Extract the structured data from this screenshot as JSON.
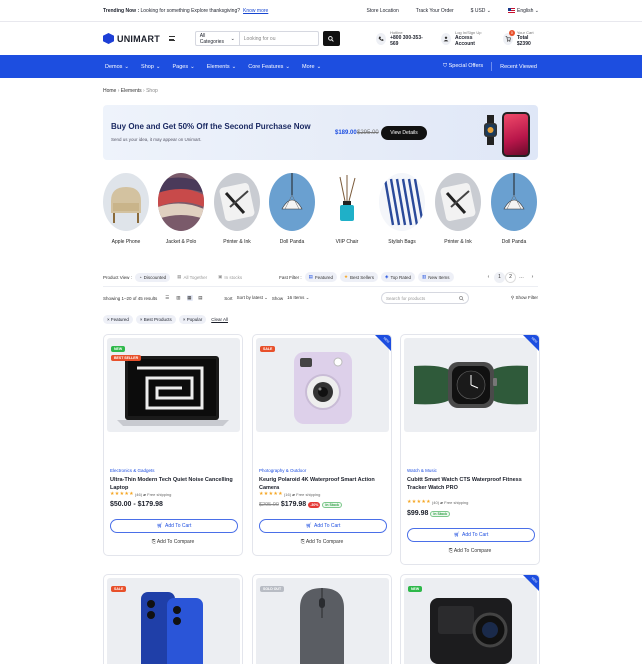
{
  "topbar": {
    "trending_label": "Trending Now :",
    "trending_text": "Looking for something Explore thanksgiving?",
    "know_more": "Know more",
    "store_location": "Store Location",
    "track_order": "Track Your Order",
    "currency": "$ USD",
    "language": "English"
  },
  "header": {
    "logo": "UNIMART",
    "category_select": "All Categories",
    "search_placeholder": "Looking for ou",
    "hotline_label": "Hotline",
    "hotline_number": "+800 300-353-569",
    "login_label": "Log In/Sign Up",
    "account_label": "Access Account",
    "cart_label": "Your Cart",
    "cart_total": "Total $2390",
    "cart_count": "0"
  },
  "nav": {
    "items": [
      "Demos",
      "Shop",
      "Pages",
      "Elements",
      "Core Features",
      "More"
    ],
    "special_offers": "Special Offers",
    "recent_viewed": "Recent Viewed"
  },
  "breadcrumb": {
    "home": "Home",
    "elements": "Elements",
    "shop": "Shop"
  },
  "banner": {
    "title": "Buy One and Get 50% Off the Second Purchase Now",
    "subtitle": "Send us your idea, it may appear on Unimart.",
    "price_new": "$189.00",
    "price_old": "$295.00",
    "button": "View Details"
  },
  "categories": [
    "Apple Phone",
    "Jacket & Polo",
    "Printer & Ink",
    "Doll Panda",
    "VIIP Chair",
    "Stylish Bags",
    "Printer & Ink",
    "Doll Panda"
  ],
  "filters": {
    "product_view_label": "Product View :",
    "discounted": "Discounted",
    "all_together": "All Together",
    "in_stocks": "In stocks",
    "fast_filter_label": "Fast Filter :",
    "featured": "Featured",
    "best_sellers": "Best Sellers",
    "top_rated": "Top Rated",
    "new_items": "New Items",
    "page1": "1",
    "page2": "2"
  },
  "toolbar": {
    "results": "Showing 1–20 of 45 results",
    "sort_label": "Sort",
    "sort_value": "Sort by latest",
    "show_label": "Show",
    "show_value": "16 Items",
    "search_placeholder": "Search for products",
    "show_filter": "Show Filter"
  },
  "active_filters": {
    "featured": "Featured",
    "best_products": "Best Products",
    "popular": "Popular",
    "clear": "Clear All"
  },
  "products": [
    {
      "category": "Electronics & Gadgets",
      "name": "Ultra-Thin Modern Tech Quiet Noise Cancelling Laptop",
      "reviews": "(46)",
      "shipping": "Free shipping",
      "price": "$50.00 - $179.98",
      "price_old": "",
      "discount": "",
      "stock": "",
      "label_new": "NEW",
      "label_best": "BEST SELLER",
      "add_to_cart": "Add To Cart",
      "compare": "Add To Compare"
    },
    {
      "category": "Photography & Outdoor",
      "name": "Keurig Polaroid 4K Waterproof Smart Action Camera",
      "reviews": "(16)",
      "shipping": "Free shipping",
      "price": "$179.98",
      "price_old": "$295.00",
      "discount": "-30%",
      "stock": "In Stock",
      "label_sale": "SALE",
      "corner": "NEW",
      "add_to_cart": "Add To Cart",
      "compare": "Add To Compare"
    },
    {
      "category": "Watch & Music",
      "name": "Cubitt Smart Watch CTS Waterproof Fitness Tracker Watch PRO",
      "reviews": "(40)",
      "shipping": "Free shipping",
      "price": "$99.98",
      "stock": "In Stock",
      "corner": "NEW",
      "add_to_cart": "Add To Cart",
      "compare": "Add To Compare"
    }
  ],
  "products_row2": [
    {
      "label": "SALE"
    },
    {
      "label": "SOLD OUT"
    },
    {
      "label": "NEW",
      "corner": "NEW"
    }
  ],
  "colors": {
    "accent": "#1d4ee0",
    "sale": "#e8502b",
    "new": "#2eb84a"
  }
}
